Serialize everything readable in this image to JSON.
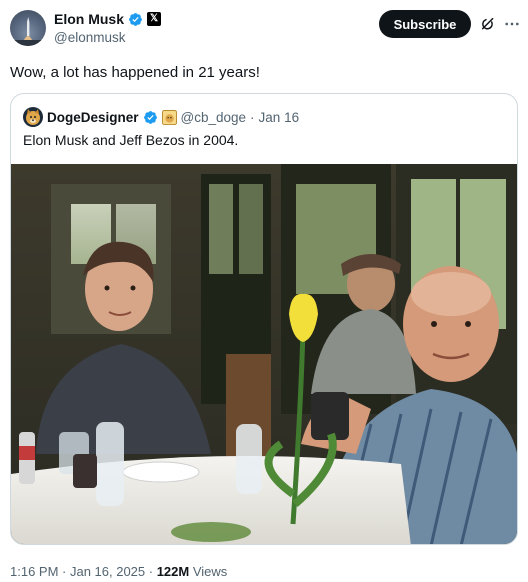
{
  "author": {
    "name": "Elon Musk",
    "handle": "@elonmusk",
    "x_badge_label": "𝕏",
    "subscribe_label": "Subscribe"
  },
  "tweet": {
    "text": "Wow, a lot has happened in 21 years!"
  },
  "quote": {
    "name": "DogeDesigner",
    "handle": "@cb_doge",
    "separator": "·",
    "date": "Jan 16",
    "text": "Elon Musk and Jeff Bezos in 2004."
  },
  "footer": {
    "time_date": "1:16 PM · Jan 16, 2025 · ",
    "views_count": "122M",
    "views_label": "Views"
  },
  "colors": {
    "verified_blue": "#1d9bf0",
    "text_primary": "#0f1419",
    "text_secondary": "#536471",
    "border": "#cfd9de"
  },
  "icons": [
    "verified-icon",
    "x-logo-icon",
    "grok-icon",
    "more-icon",
    "doge-icon"
  ]
}
